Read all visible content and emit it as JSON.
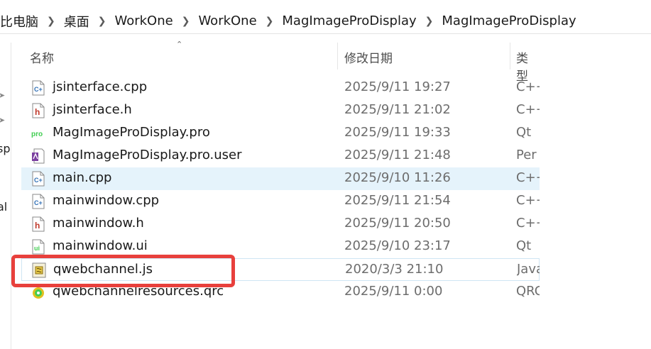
{
  "breadcrumb": {
    "items": [
      "此电脑",
      "桌面",
      "WorkOne",
      "WorkOne",
      "MagImageProDisplay",
      "MagImageProDisplay"
    ],
    "first_visible": "比电脑",
    "separator": ">"
  },
  "left_nav": {
    "cut_labels": [
      "sp",
      "al"
    ]
  },
  "columns": {
    "name": "名称",
    "date": "修改日期",
    "type": "类型"
  },
  "files": [
    {
      "name": "jsinterface.cpp",
      "date": "2025/9/11 19:27",
      "type": "C++",
      "icon": "cpp-file-icon"
    },
    {
      "name": "jsinterface.h",
      "date": "2025/9/11 21:02",
      "type": "C++",
      "icon": "header-file-icon"
    },
    {
      "name": "MagImageProDisplay.pro",
      "date": "2025/9/11 19:33",
      "type": "Qt",
      "icon": "qt-pro-file-icon"
    },
    {
      "name": "MagImageProDisplay.pro.user",
      "date": "2025/9/11 21:48",
      "type": "Per",
      "icon": "user-file-icon"
    },
    {
      "name": "main.cpp",
      "date": "2025/9/10 11:26",
      "type": "C++",
      "icon": "cpp-file-icon"
    },
    {
      "name": "mainwindow.cpp",
      "date": "2025/9/11 21:54",
      "type": "C++",
      "icon": "cpp-file-icon"
    },
    {
      "name": "mainwindow.h",
      "date": "2025/9/11 20:50",
      "type": "C++",
      "icon": "header-file-icon"
    },
    {
      "name": "mainwindow.ui",
      "date": "2025/9/10 23:17",
      "type": "Qt",
      "icon": "ui-file-icon"
    },
    {
      "name": "qwebchannel.js",
      "date": "2020/3/3 21:10",
      "type": "Java",
      "icon": "js-file-icon"
    },
    {
      "name": "qwebchannelresources.qrc",
      "date": "2025/9/11 0:00",
      "type": "QRC",
      "icon": "qrc-file-icon"
    }
  ],
  "colors": {
    "selected_row": "#e5f3fb",
    "annotation_red": "#e8403c",
    "cpp_icon": "#2f6fb5",
    "header_icon": "#c0392b",
    "qt_icon": "#41cd52"
  }
}
